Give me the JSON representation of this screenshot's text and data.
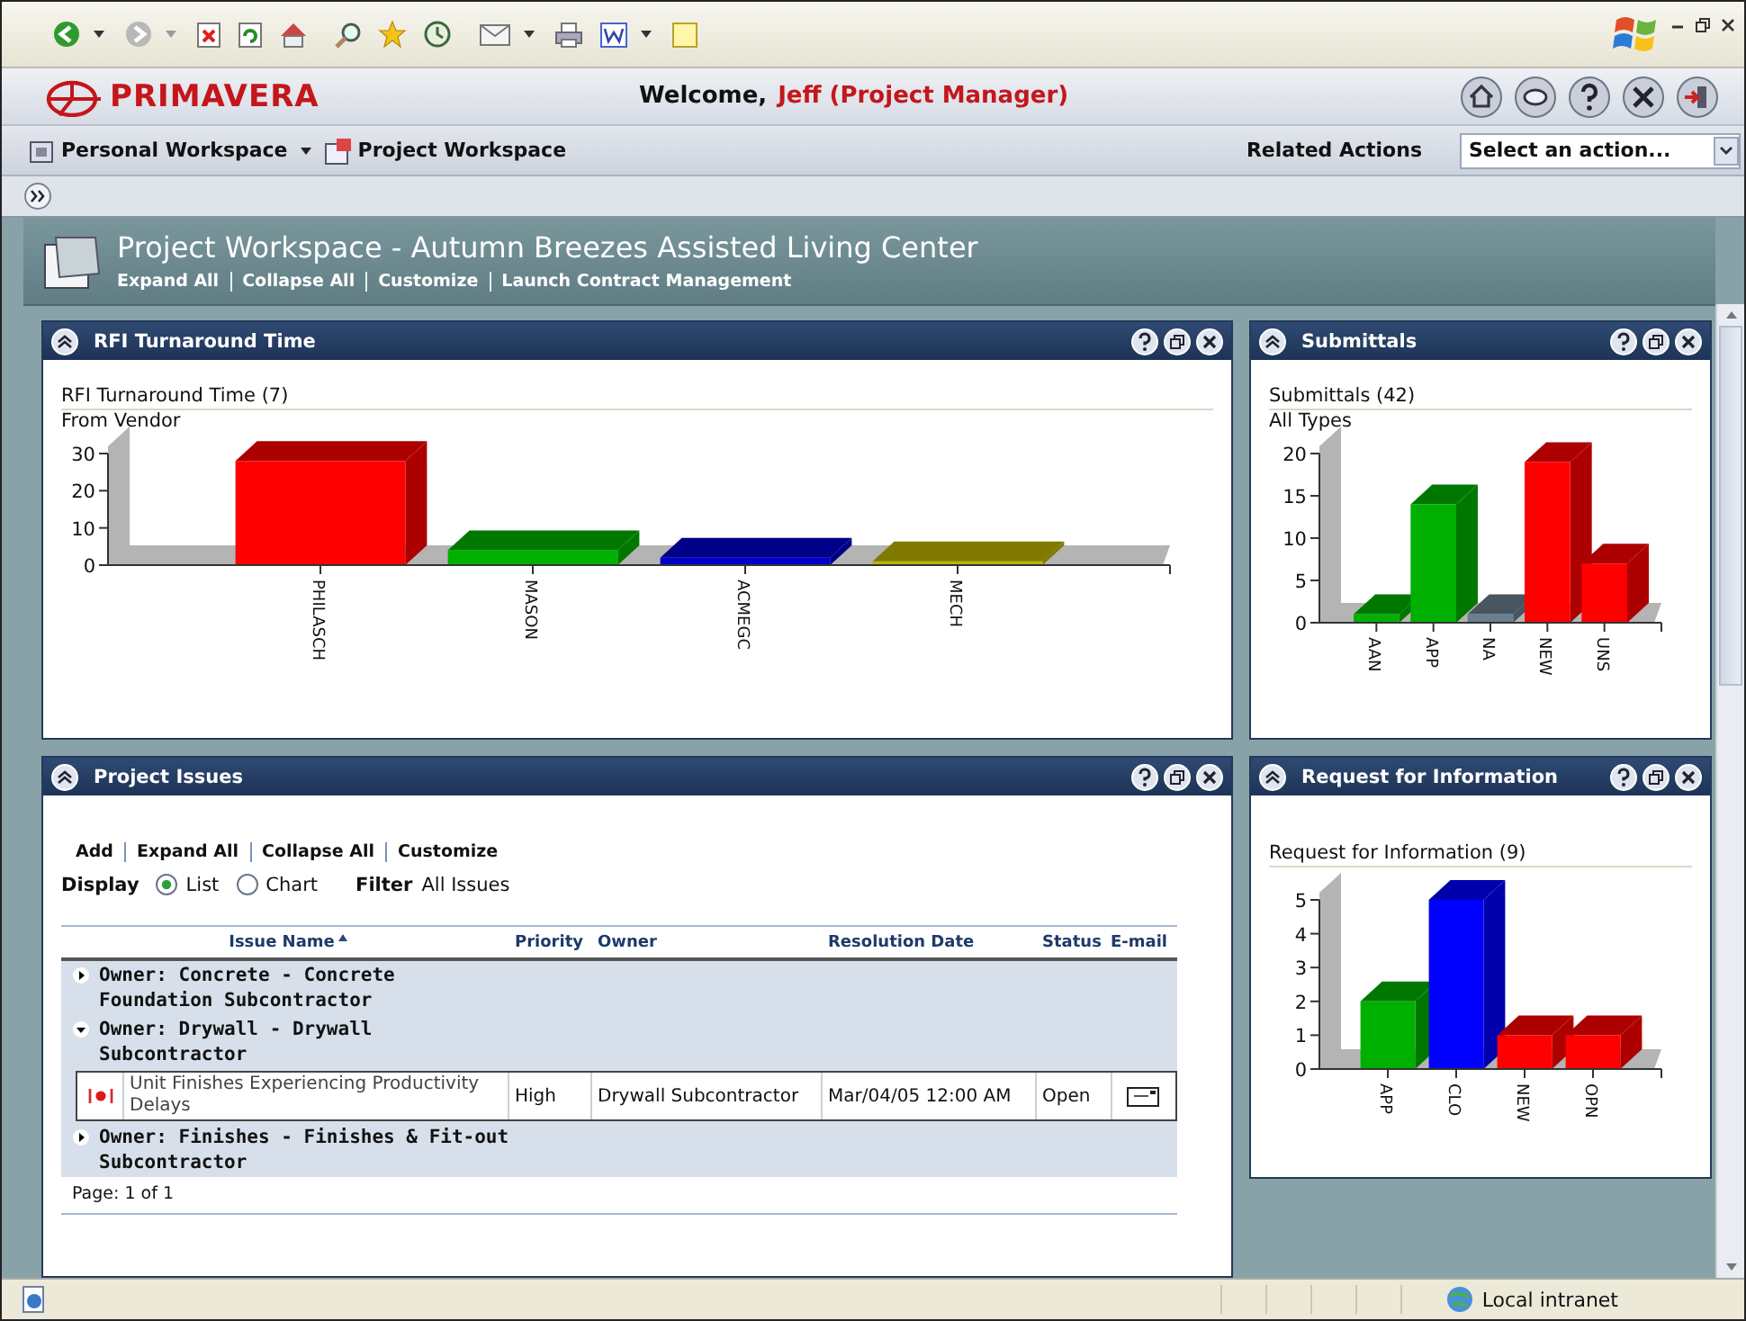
{
  "header": {
    "brand": "PRIMAVERA",
    "welcome": "Welcome,",
    "user": "Jeff (Project Manager)"
  },
  "nav": {
    "items": [
      "Personal Workspace",
      "Project Workspace"
    ],
    "related_label": "Related Actions",
    "action_select": {
      "value": "Select an action..."
    }
  },
  "workspace": {
    "title": "Project Workspace - Autumn Breezes Assisted Living Center",
    "links": [
      "Expand All",
      "Collapse All",
      "Customize",
      "Launch Contract Management"
    ]
  },
  "columns": [
    {
      "portlets": [
        {
          "kind": "chart",
          "title": "RFI Turnaround Time",
          "heading": "RFI Turnaround Time (7)",
          "subheading": "From Vendor",
          "chart_data": {
            "type": "bar",
            "categories": [
              "PHILASCH",
              "MASON",
              "ACMEGC",
              "MECH"
            ],
            "series": [
              {
                "colors": [
                  "#ff0000",
                  "#00b000",
                  "#0000c8",
                  "#bcb400"
                ],
                "values": [
                  28,
                  4,
                  2,
                  1
                ]
              }
            ],
            "ylim": [
              0,
              30
            ],
            "yticks": [
              0,
              10,
              20,
              30
            ]
          }
        },
        {
          "kind": "issues",
          "title": "Project Issues",
          "links": [
            "Add",
            "Expand All",
            "Collapse All",
            "Customize"
          ],
          "display_label": "Display",
          "display_options": [
            {
              "label": "List",
              "selected": true
            },
            {
              "label": "Chart",
              "selected": false
            }
          ],
          "filter_label": "Filter",
          "filter_value": "All Issues",
          "table_columns": [
            "Issue Name",
            "Priority",
            "Owner",
            "Resolution Date",
            "Status",
            "E-mail"
          ],
          "groups": [
            {
              "label": "Owner: Concrete - Concrete Foundation Subcontractor",
              "expanded": false
            },
            {
              "label": "Owner: Drywall - Drywall Subcontractor",
              "expanded": true,
              "rows": [
                {
                  "issue": "Unit Finishes Experiencing Productivity Delays",
                  "priority": "High",
                  "owner": "Drywall Subcontractor",
                  "resolution_date": "Mar/04/05 12:00 AM",
                  "status": "Open"
                }
              ]
            },
            {
              "label": "Owner: Finishes - Finishes & Fit-out Subcontractor",
              "expanded": false
            }
          ],
          "pagination": "Page: 1 of 1"
        }
      ]
    },
    {
      "portlets": [
        {
          "kind": "chart",
          "title": "Submittals",
          "heading": "Submittals (42)",
          "subheading": "All Types",
          "chart_data": {
            "type": "bar",
            "categories": [
              "AAN",
              "APP",
              "NA",
              "NEW",
              "UNS"
            ],
            "series": [
              {
                "colors": [
                  "#00b000",
                  "#00b000",
                  "#6a7f8f",
                  "#ff0000",
                  "#ff0000"
                ],
                "values": [
                  1,
                  14,
                  1,
                  19,
                  7
                ]
              }
            ],
            "ylim": [
              0,
              20
            ],
            "yticks": [
              0,
              5,
              10,
              15,
              20
            ]
          }
        },
        {
          "kind": "chart",
          "title": "Request for Information",
          "heading": "Request for Information (9)",
          "chart_data": {
            "type": "bar",
            "categories": [
              "APP",
              "CLO",
              "NEW",
              "OPN"
            ],
            "series": [
              {
                "colors": [
                  "#00b000",
                  "#0000ff",
                  "#ff0000",
                  "#ff0000"
                ],
                "values": [
                  2,
                  5,
                  1,
                  1
                ]
              }
            ],
            "ylim": [
              0,
              5
            ],
            "yticks": [
              0,
              1,
              2,
              3,
              4,
              5
            ]
          }
        }
      ]
    }
  ],
  "status_bar": {
    "zone": "Local intranet"
  }
}
